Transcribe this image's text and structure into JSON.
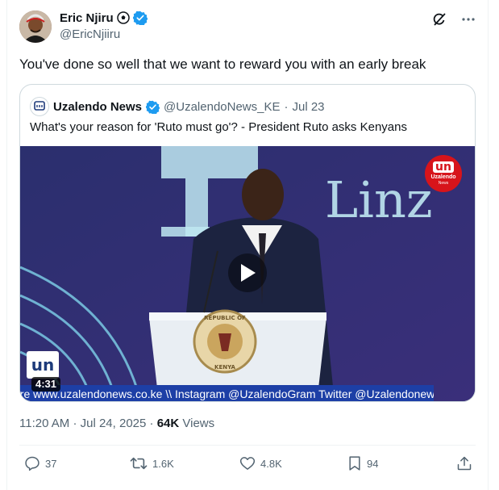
{
  "author": {
    "display_name": "Eric Njiru",
    "handle": "@EricNjiiru",
    "avatar": "avatar-photo"
  },
  "header": {
    "icons": [
      "grok-icon",
      "more-icon"
    ]
  },
  "tweet": {
    "text": "You've done so well that we want to reward you with an early break"
  },
  "quote": {
    "name": "Uzalendo News",
    "handle": "@UzalendoNews_KE",
    "separator": "·",
    "date": "Jul 23",
    "text": "What's your reason for 'Ruto must go'? - President Ruto asks Kenyans",
    "video": {
      "duration": "4:31",
      "ticker": "ore www.uzalendonews.co.ke  \\\\  Instagram @UzalendoGram  Twitter @Uzalendonew",
      "backdrop_text": "Linz",
      "badge_logo": "un",
      "badge_name": "Uzalendo",
      "badge_sub": "News",
      "watermark": "un",
      "seal_top": "REPUBLIC OF",
      "seal_bottom": "KENYA"
    }
  },
  "meta": {
    "time": "11:20 AM",
    "dot": "·",
    "date": "Jul 24, 2025",
    "dot2": "·",
    "views_count": "64K",
    "views_label": "Views"
  },
  "actions": {
    "replies": "37",
    "reposts": "1.6K",
    "likes": "4.8K",
    "bookmarks": "94"
  },
  "colors": {
    "text": "#0f1419",
    "secondary": "#536471",
    "verified": "#1d9bf0",
    "border": "#cfd9de"
  }
}
